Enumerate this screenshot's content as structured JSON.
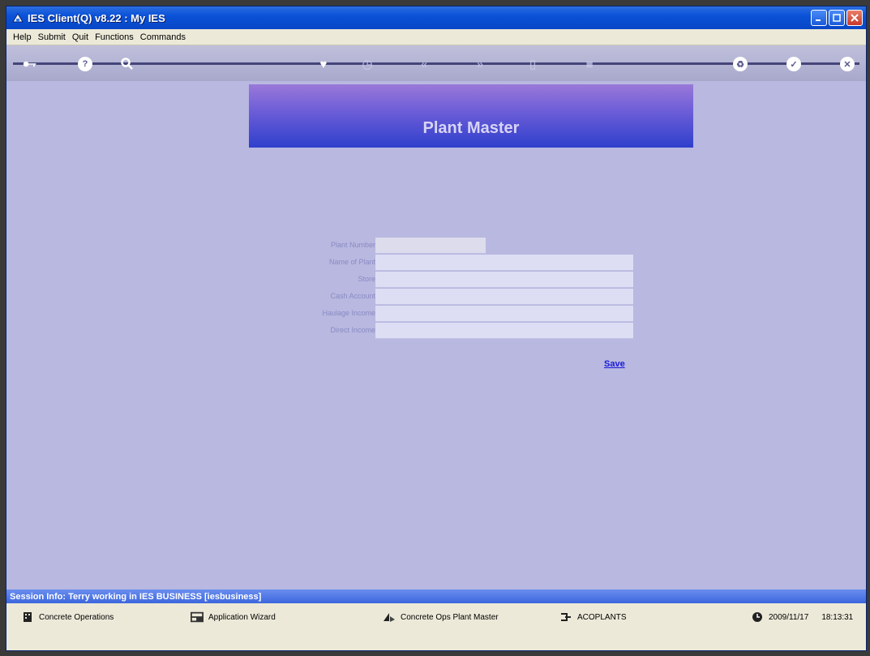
{
  "window": {
    "title": "IES Client(Q) v8.22 : My IES"
  },
  "menu": [
    "Help",
    "Submit",
    "Quit",
    "Functions",
    "Commands"
  ],
  "toolbar": [
    {
      "icon": "key-icon"
    },
    {
      "icon": "help-icon"
    },
    {
      "icon": "search-icon"
    },
    {
      "icon": "heart-icon"
    },
    {
      "icon": "clock-icon"
    },
    {
      "icon": "previous-icon"
    },
    {
      "icon": "next-icon"
    },
    {
      "icon": "delete-icon"
    },
    {
      "icon": "stop-icon"
    },
    {
      "icon": "recycle-icon"
    },
    {
      "icon": "ok-icon"
    },
    {
      "icon": "close-icon"
    }
  ],
  "page": {
    "title": "Plant Master"
  },
  "form": {
    "fields": [
      {
        "label": "Plant Number",
        "value": ""
      },
      {
        "label": "Name of Plant",
        "value": ""
      },
      {
        "label": "Store",
        "value": ""
      },
      {
        "label": "Cash Account",
        "value": ""
      },
      {
        "label": "Haulage Income",
        "value": ""
      },
      {
        "label": "Direct Income",
        "value": ""
      }
    ],
    "save_label": "Save"
  },
  "session": {
    "info": "Session Info: Terry working in IES BUSINESS  [iesbusiness]"
  },
  "status": {
    "module": "Concrete Operations",
    "wizard": "Application Wizard",
    "screen": "Concrete Ops Plant Master",
    "code": "ACOPLANTS",
    "date": "2009/11/17",
    "time": "18:13:31"
  },
  "colors": {
    "accent": "#0a52d8",
    "background": "#b8b8e0",
    "banner": "#2f3fcc"
  }
}
